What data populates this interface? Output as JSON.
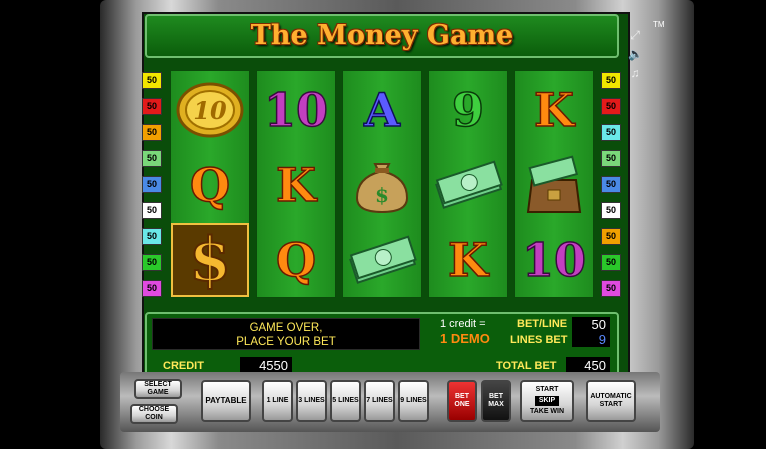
{
  "game": {
    "title": "The Money Game",
    "trademark": "TM"
  },
  "side_icons": [
    "fullscreen-icon",
    "sound-icon",
    "music-icon"
  ],
  "paylines": {
    "left": [
      {
        "value": "50",
        "color": "#f2e600"
      },
      {
        "value": "50",
        "color": "#e31a1a"
      },
      {
        "value": "50",
        "color": "#f2a000"
      },
      {
        "value": "50",
        "color": "#7ad87a"
      },
      {
        "value": "50",
        "color": "#4a8ae6"
      },
      {
        "value": "50",
        "color": "#ffffff"
      },
      {
        "value": "50",
        "color": "#6ae8e8"
      },
      {
        "value": "50",
        "color": "#2ac82a"
      },
      {
        "value": "50",
        "color": "#e04ae0"
      }
    ],
    "right": [
      {
        "value": "50",
        "color": "#f2e600"
      },
      {
        "value": "50",
        "color": "#e31a1a"
      },
      {
        "value": "50",
        "color": "#6ae8e8"
      },
      {
        "value": "50",
        "color": "#7ad87a"
      },
      {
        "value": "50",
        "color": "#4a8ae6"
      },
      {
        "value": "50",
        "color": "#ffffff"
      },
      {
        "value": "50",
        "color": "#f2a000"
      },
      {
        "value": "50",
        "color": "#2ac82a"
      },
      {
        "value": "50",
        "color": "#e04ae0"
      }
    ]
  },
  "reels": [
    [
      "coin",
      "Q",
      "dollar"
    ],
    [
      "10",
      "K",
      "Q"
    ],
    [
      "A",
      "money-bag",
      "cash-stack"
    ],
    [
      "9",
      "cash-stack",
      "K"
    ],
    [
      "K",
      "bag-of-cash",
      "10"
    ]
  ],
  "message": {
    "line1": "GAME OVER,",
    "line2": "PLACE YOUR BET"
  },
  "credit_info": {
    "line1": "1 credit =",
    "line2": "1 DEMO"
  },
  "labels": {
    "bet_line": "BET/LINE",
    "lines_bet": "LINES BET",
    "credit": "CREDIT",
    "total_bet": "TOTAL BET"
  },
  "values": {
    "bet_line": "50",
    "lines_bet": "9",
    "credit": "4550",
    "total_bet": "450"
  },
  "buttons": {
    "select_game": "SELECT GAME",
    "choose_coin": "CHOOSE COIN",
    "paytable": "PAYTABLE",
    "line1": "1 LINE",
    "line3": "3 LINES",
    "line5": "5 LINES",
    "line7": "7 LINES",
    "line9": "9 LINES",
    "bet_one": "BET ONE",
    "bet_max": "BET MAX",
    "start": "START",
    "skip": "SKIP",
    "take_win": "TAKE WIN",
    "automatic_start": "AUTOMATIC START"
  }
}
